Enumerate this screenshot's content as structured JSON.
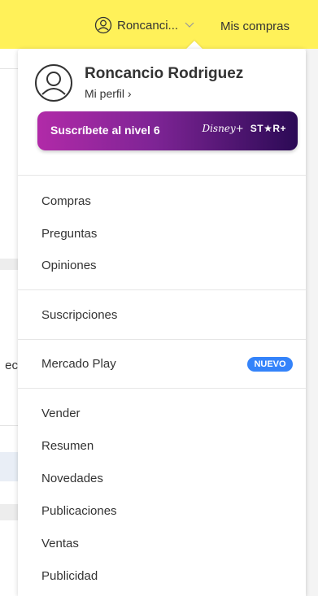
{
  "header": {
    "user_short": "Roncanci...",
    "my_purchases": "Mis compras",
    "user_icon": "user-circle-icon",
    "chevron_icon": "chevron-down-icon"
  },
  "background": {
    "partial_text": "ec"
  },
  "profile": {
    "name": "Roncancio Rodriguez",
    "link": "Mi perfil ›",
    "avatar_icon": "user-circle-icon"
  },
  "banner": {
    "text": "Suscríbete al nivel 6",
    "logo_disney": "Disney+",
    "logo_star": "ST★R+",
    "gradient_start": "#b12aa8",
    "gradient_end": "#2b0a55"
  },
  "menu": {
    "group1": [
      "Compras",
      "Preguntas",
      "Opiniones"
    ],
    "group2": [
      "Suscripciones"
    ],
    "group3": {
      "label": "Mercado Play",
      "badge": "NUEVO"
    },
    "group4": [
      "Vender",
      "Resumen",
      "Novedades",
      "Publicaciones",
      "Ventas",
      "Publicidad"
    ]
  },
  "colors": {
    "topbar": "#fff159",
    "badge": "#3483fa"
  }
}
